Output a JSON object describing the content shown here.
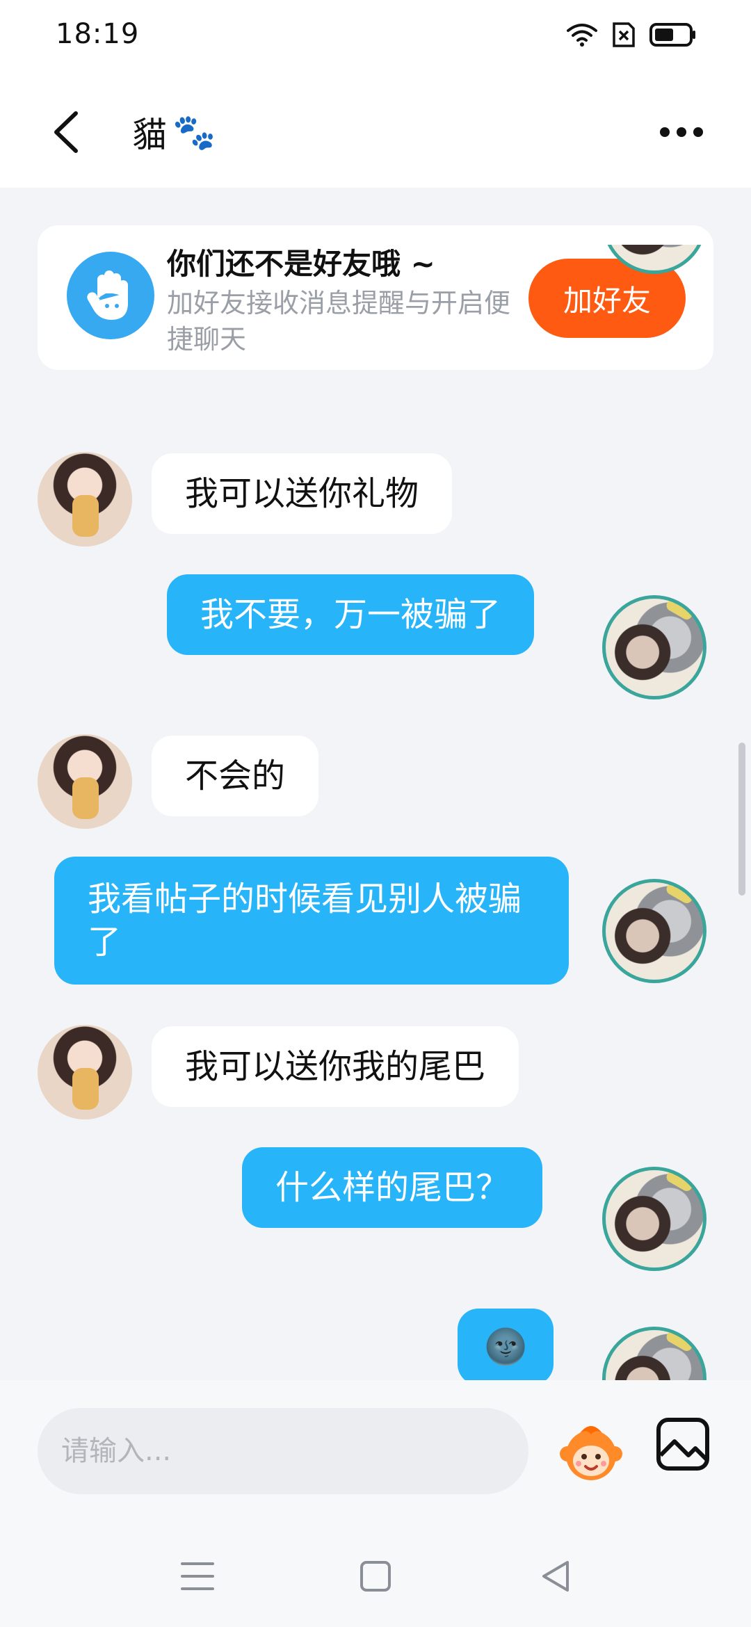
{
  "status_bar": {
    "time": "18:19"
  },
  "header": {
    "title": "貓",
    "title_emoji": "🐾"
  },
  "friend_banner": {
    "title": "你们还不是好友哦 ~",
    "subtitle": "加好友接收消息提醒与开启便捷聊天",
    "button_label": "加好友"
  },
  "messages": [
    {
      "from": "other",
      "text": "我可以送你礼物"
    },
    {
      "from": "me",
      "text": "我不要，万一被骗了"
    },
    {
      "from": "other",
      "text": "不会的"
    },
    {
      "from": "me",
      "text": "我看帖子的时候看见别人被骗了"
    },
    {
      "from": "other",
      "text": "我可以送你我的尾巴"
    },
    {
      "from": "me",
      "text": "什么样的尾巴？"
    },
    {
      "from": "me",
      "text": "🌚"
    }
  ],
  "input": {
    "placeholder": "请输入..."
  },
  "colors": {
    "accent_blue": "#27b4f8",
    "add_friend_orange": "#ff5a12",
    "chat_background": "#f2f4f8"
  }
}
